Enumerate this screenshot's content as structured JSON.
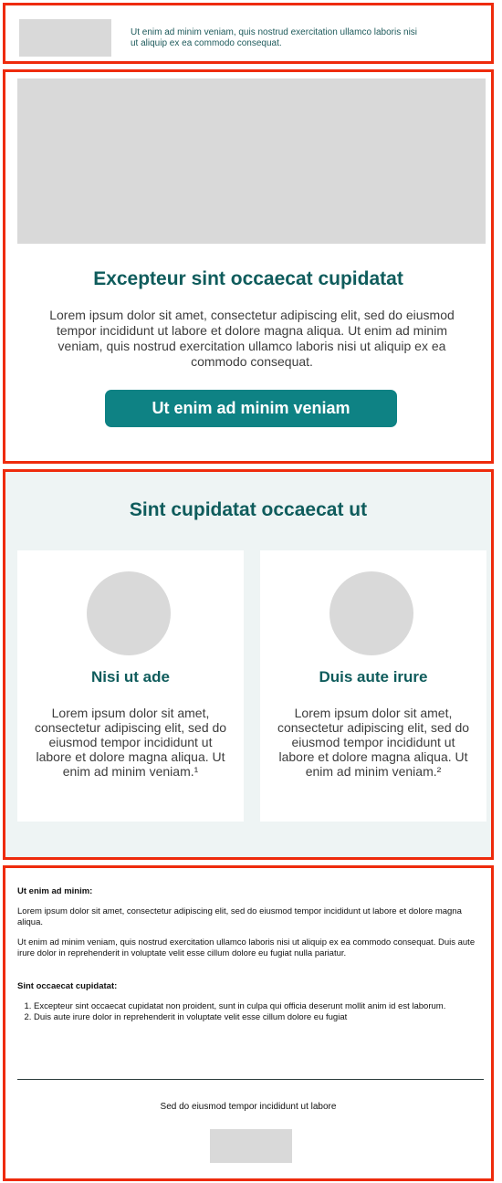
{
  "colors": {
    "frame_border": "#ee2b0c",
    "heading": "#0f5c5c",
    "button": "#0e8284",
    "placeholder": "#d9d9d9",
    "features_bg": "#eef4f4"
  },
  "header": {
    "text": "Ut enim ad minim veniam, quis nostrud exercitation ullamco laboris nisi ut aliquip ex ea commodo consequat."
  },
  "hero": {
    "title": "Excepteur sint occaecat cupidatat",
    "body": "Lorem ipsum dolor sit amet, consectetur adipiscing elit, sed do eiusmod tempor incididunt ut labore et dolore magna aliqua. Ut enim ad minim veniam, quis nostrud exercitation ullamco laboris nisi ut aliquip ex ea commodo consequat.",
    "cta_label": "Ut enim ad minim veniam"
  },
  "features": {
    "title": "Sint cupidatat occaecat ut",
    "cards": [
      {
        "title": "Nisi ut ade",
        "text": "Lorem ipsum dolor sit amet, consectetur adipiscing elit, sed do eiusmod tempor incididunt ut labore et dolore magna aliqua. Ut enim ad minim veniam.¹"
      },
      {
        "title": "Duis aute irure",
        "text": "Lorem ipsum dolor sit amet, consectetur adipiscing elit, sed do eiusmod tempor incididunt ut labore et dolore magna aliqua. Ut enim ad minim veniam.²"
      }
    ]
  },
  "footer": {
    "heading1": "Ut enim ad minim:",
    "para1": "Lorem ipsum dolor sit amet, consectetur adipiscing elit, sed do eiusmod tempor incididunt ut labore et dolore magna aliqua.",
    "para2": "Ut enim ad minim veniam, quis nostrud exercitation ullamco laboris nisi ut aliquip ex ea commodo consequat. Duis aute irure dolor in reprehenderit in voluptate velit esse cillum dolore eu fugiat nulla pariatur.",
    "heading2": "Sint occaecat cupidatat:",
    "list": [
      "Excepteur sint occaecat cupidatat non proident, sunt in culpa qui officia deserunt mollit anim id est laborum.",
      "Duis aute irure dolor in reprehenderit in voluptate velit esse cillum dolore eu fugiat"
    ],
    "tagline": "Sed do eiusmod tempor incididunt ut labore"
  }
}
